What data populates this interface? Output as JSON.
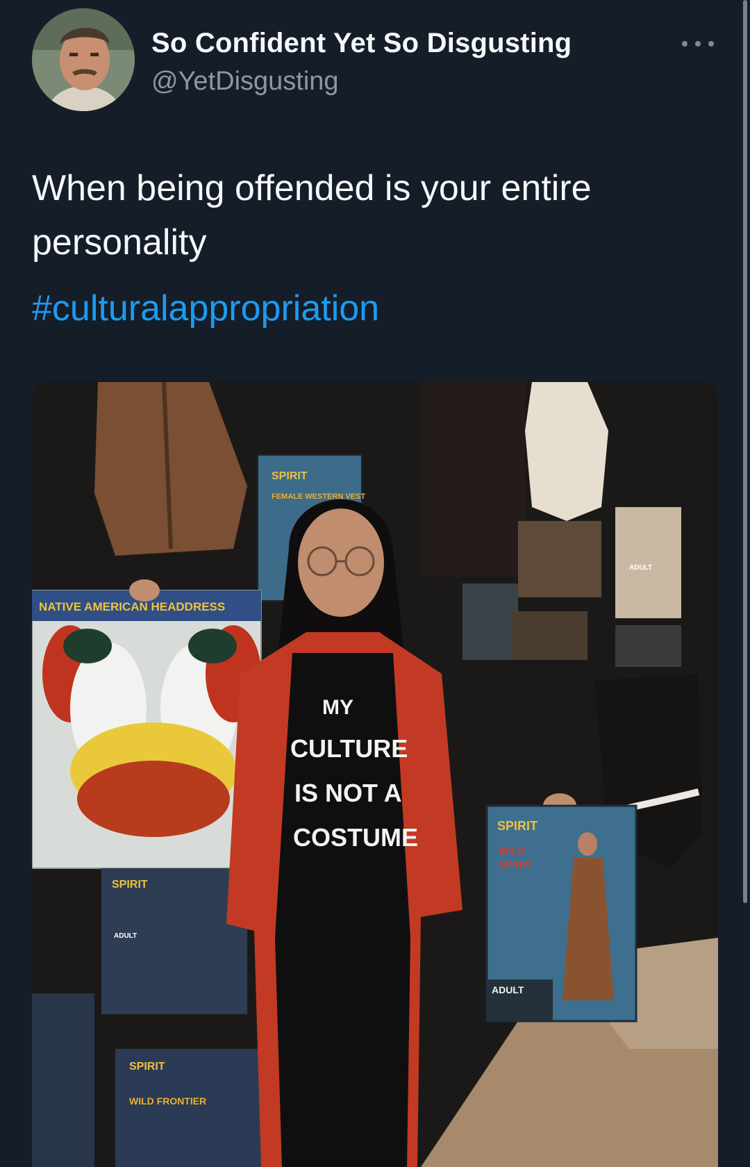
{
  "tweet": {
    "display_name": "So Confident Yet So Disgusting",
    "handle": "@YetDisgusting",
    "text": "When being offended is your entire personality",
    "hashtag": "#culturalappropriation"
  },
  "photo": {
    "shirt_lines": [
      "MY",
      "CULTURE",
      "IS NOT A",
      "COSTUME"
    ],
    "left_package_title": "NATIVE AMERICAN HEADDRESS",
    "left_package_brand": "SPIRIT",
    "right_package_brand": "SPIRIT",
    "right_package_title_line1": "WILD",
    "right_package_title_line2": "SPIRIT",
    "right_package_badge": "ADULT",
    "top_package_brand": "SPIRIT",
    "top_package_title": "FEMALE WESTERN VEST",
    "bottom_package_brand": "SPIRIT",
    "bottom_package_title": "WILD FRONTIER",
    "tag_adult": "ADULT"
  },
  "colors": {
    "background": "#151d28",
    "text_primary": "#f5f7fa",
    "text_secondary": "#8b98a5",
    "link": "#1d9bf0"
  }
}
